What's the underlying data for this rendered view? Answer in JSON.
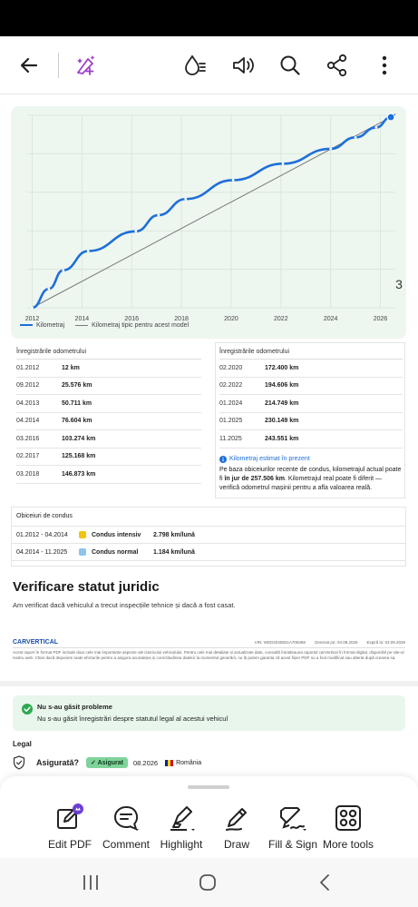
{
  "app": {
    "toolbar_icons": [
      "back-arrow-icon",
      "ai-assistant-icon",
      "reading-mode-icon",
      "read-aloud-icon",
      "search-icon",
      "share-icon",
      "more-icon"
    ],
    "page_number": "3",
    "colors": {
      "accent": "#1e6fd9",
      "chart_bg": "#eef6f0",
      "green_box": "#e8f6ec",
      "green": "#2fa84f",
      "yellow": "#f2c40f",
      "light_blue": "#8cc4f0"
    }
  },
  "chart_data": {
    "type": "line",
    "x_ticks": [
      "2012",
      "2014",
      "2016",
      "2018",
      "2020",
      "2022",
      "2024",
      "2026"
    ],
    "xlim": [
      2011.8,
      2026.6
    ],
    "ylim": [
      0,
      260000
    ],
    "grid": true,
    "legend_position": "bottom-left",
    "series": [
      {
        "name": "Kilometraj",
        "style": "dotted-line",
        "color": "#1e6fd9",
        "x": [
          2012.0,
          2012.67,
          2013.25,
          2014.25,
          2016.17,
          2017.08,
          2018.17,
          2020.08,
          2022.08,
          2024.0,
          2025.0,
          2025.83,
          2026.42
        ],
        "y": [
          12,
          25576,
          50711,
          76604,
          103274,
          125168,
          146873,
          172400,
          194606,
          214749,
          230149,
          243551,
          257506
        ]
      },
      {
        "name": "Kilometraj tipic pentru acest model",
        "style": "line",
        "color": "#7a7a7a",
        "x": [
          2012.0,
          2026.42
        ],
        "y": [
          0,
          257506
        ]
      }
    ]
  },
  "odometer": {
    "header": "Înregistrările odometrului",
    "left": [
      {
        "date": "01.2012",
        "km": "12 km"
      },
      {
        "date": "09.2012",
        "km": "25.576 km"
      },
      {
        "date": "04.2013",
        "km": "50.711 km"
      },
      {
        "date": "04.2014",
        "km": "76.604 km"
      },
      {
        "date": "03.2016",
        "km": "103.274 km"
      },
      {
        "date": "02.2017",
        "km": "125.168 km"
      },
      {
        "date": "03.2018",
        "km": "146.873 km"
      }
    ],
    "right": [
      {
        "date": "02.2020",
        "km": "172.400 km"
      },
      {
        "date": "02.2022",
        "km": "194.606 km"
      },
      {
        "date": "01.2024",
        "km": "214.749 km"
      },
      {
        "date": "01.2025",
        "km": "230.149 km"
      },
      {
        "date": "11.2025",
        "km": "243.551 km"
      }
    ],
    "estimate_title": "Kilometraj estimat în prezent",
    "estimate_text_1": "Pe baza obiceiurilor recente de condus, kilometrajul actual poate fi",
    "estimate_text_bold": "în jur de 257.506 km",
    "estimate_text_2": ". Kilometrajul real poate fi diferit — verifică odometrul mașinii pentru a afla valoarea reală."
  },
  "habits": {
    "header": "Obiceiuri de condus",
    "rows": [
      {
        "period": "01.2012 - 04.2014",
        "label": "Condus intensiv",
        "rate": "2.798 km/lună",
        "color": "#f2c40f"
      },
      {
        "period": "04.2014 - 11.2025",
        "label": "Condus normal",
        "rate": "1.184 km/lună",
        "color": "#8cc4f0"
      }
    ]
  },
  "legal_check": {
    "title": "Verificare statut juridic",
    "subtitle": "Am verificat dacă vehiculul a trecut inspecțiile tehnice și dacă a fost casat."
  },
  "footer": {
    "brand": "CARVERTICAL",
    "vin": "VIN: WDD2040821A709358",
    "generated": "Generat pe: 04.08.2026",
    "expires": "Expiră la: 03.09.2026",
    "disclaimer": "Acest raport în format PDF include doar cele mai importante aspecte ale istoricului vehiculului. Pentru cele mai detaliate și actualizate date, consultă întotdeauna raportul carVertical în format digital, disponibil pe site-ul nostru web. Chiar dacă depunem toate eforturile pentru a asigura acuratețea și corectitudinea datelor la momentul generării, nu îți putem garanta că acest fișier PDF nu a fost modificat sau alterat după crearea sa."
  },
  "status_box": {
    "title": "Nu s-au găsit probleme",
    "text": "Nu s-au găsit înregistrări despre statutul legal al acestui vehicul"
  },
  "legal": {
    "heading": "Legal",
    "insured_label": "Asigurată?",
    "insured_badge": "Asigurat",
    "insured_date": "08.2026",
    "country": "România"
  },
  "bottom_tools": [
    {
      "label": "Edit PDF",
      "icon": "edit-pdf-icon"
    },
    {
      "label": "Comment",
      "icon": "comment-icon"
    },
    {
      "label": "Highlight",
      "icon": "highlight-icon"
    },
    {
      "label": "Draw",
      "icon": "draw-icon"
    },
    {
      "label": "Fill & Sign",
      "icon": "fill-sign-icon"
    },
    {
      "label": "More tools",
      "icon": "more-tools-icon"
    }
  ],
  "nav": {
    "buttons": [
      "recent-apps-icon",
      "home-icon",
      "back-icon"
    ]
  }
}
